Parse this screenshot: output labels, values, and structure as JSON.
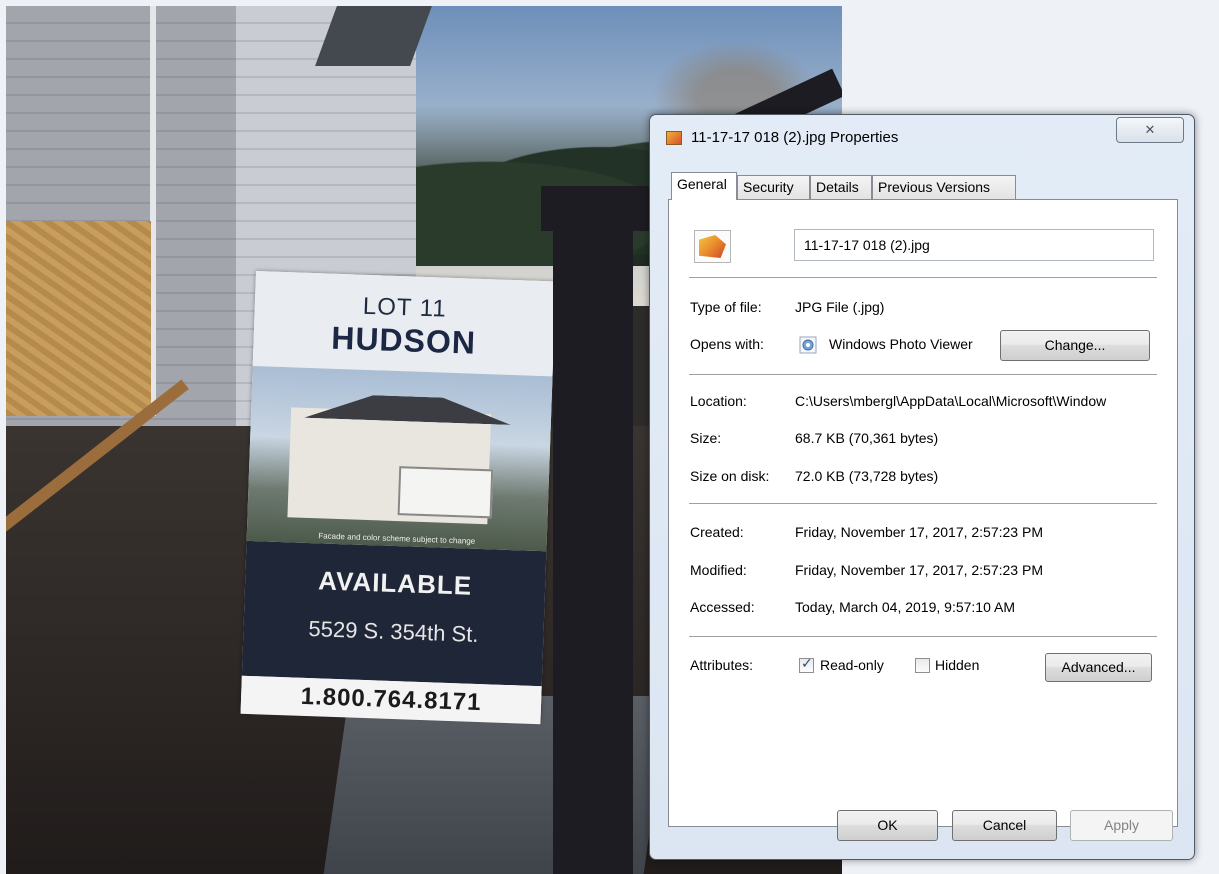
{
  "photo": {
    "sign": {
      "lot": "LOT 11",
      "model": "HUDSON",
      "caption": "Facade and color scheme subject to change",
      "status": "AVAILABLE",
      "address": "5529 S. 354th St.",
      "phone": "1.800.764.8171"
    }
  },
  "dialog": {
    "title": "11-17-17 018 (2).jpg Properties",
    "close_glyph": "✕",
    "tabs": [
      {
        "label": "General",
        "active": true
      },
      {
        "label": "Security",
        "active": false
      },
      {
        "label": "Details",
        "active": false
      },
      {
        "label": "Previous Versions",
        "active": false
      }
    ],
    "general": {
      "file_name": "11-17-17 018 (2).jpg",
      "type_label": "Type of file:",
      "type_value": "JPG File (.jpg)",
      "opens_label": "Opens with:",
      "opens_value": "Windows Photo Viewer",
      "change_button": "Change...",
      "location_label": "Location:",
      "location_value": "C:\\Users\\mbergl\\AppData\\Local\\Microsoft\\Window",
      "size_label": "Size:",
      "size_value": "68.7 KB (70,361 bytes)",
      "size_on_disk_label": "Size on disk:",
      "size_on_disk_value": "72.0 KB (73,728 bytes)",
      "created_label": "Created:",
      "created_value": "Friday, November 17, 2017, 2:57:23 PM",
      "modified_label": "Modified:",
      "modified_value": "Friday, November 17, 2017, 2:57:23 PM",
      "accessed_label": "Accessed:",
      "accessed_value": "Today, March 04, 2019, 9:57:10 AM",
      "attributes_label": "Attributes:",
      "readonly_label": "Read-only",
      "readonly_checked": true,
      "hidden_label": "Hidden",
      "hidden_checked": false,
      "advanced_button": "Advanced..."
    },
    "buttons": {
      "ok": "OK",
      "cancel": "Cancel",
      "apply": "Apply"
    }
  }
}
